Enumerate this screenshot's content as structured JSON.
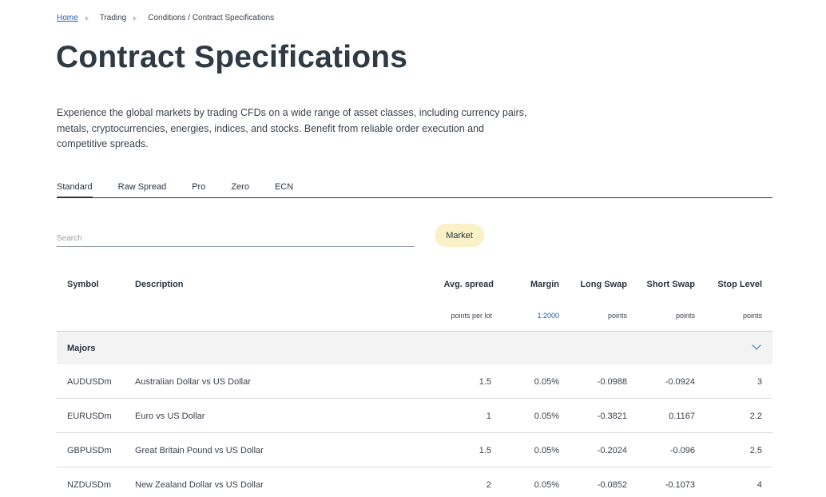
{
  "breadcrumb": {
    "home": "Home",
    "trading": "Trading",
    "current": "Conditions / Contract Specifications"
  },
  "page": {
    "title": "Contract Specifications",
    "intro": "Experience the global markets by trading CFDs on a wide range of asset classes, including currency pairs, metals, cryptocurrencies, energies, indices, and stocks. Benefit from reliable order execution and competitive spreads."
  },
  "tabs": [
    {
      "label": "Standard",
      "active": true
    },
    {
      "label": "Raw Spread"
    },
    {
      "label": "Pro"
    },
    {
      "label": "Zero"
    },
    {
      "label": "ECN"
    }
  ],
  "search": {
    "placeholder": "Search",
    "value": ""
  },
  "filter": {
    "market_label": "Market"
  },
  "table": {
    "headers": {
      "symbol": "Symbol",
      "description": "Description",
      "avg_spread": "Avg. spread",
      "margin": "Margin",
      "long_swap": "Long Swap",
      "short_swap": "Short Swap",
      "stop_level": "Stop Level"
    },
    "subheaders": {
      "avg_spread": "points per lot",
      "margin": "1:2000",
      "long_swap": "points",
      "short_swap": "points",
      "stop_level": "points"
    },
    "group": "Majors",
    "rows": [
      {
        "symbol": "AUDUSDm",
        "description": "Australian Dollar vs US Dollar",
        "avg_spread": "1.5",
        "margin": "0.05%",
        "long_swap": "-0.0988",
        "short_swap": "-0.0924",
        "stop_level": "3"
      },
      {
        "symbol": "EURUSDm",
        "description": "Euro vs US Dollar",
        "avg_spread": "1",
        "margin": "0.05%",
        "long_swap": "-0.3821",
        "short_swap": "0.1167",
        "stop_level": "2.2"
      },
      {
        "symbol": "GBPUSDm",
        "description": "Great Britain Pound vs US Dollar",
        "avg_spread": "1.5",
        "margin": "0.05%",
        "long_swap": "-0.2024",
        "short_swap": "-0.096",
        "stop_level": "2.5"
      },
      {
        "symbol": "NZDUSDm",
        "description": "New Zealand Dollar vs US Dollar",
        "avg_spread": "2",
        "margin": "0.05%",
        "long_swap": "-0.0852",
        "short_swap": "-0.1073",
        "stop_level": "4"
      }
    ]
  },
  "colors": {
    "accent": "#1f5fa8",
    "market_button": "#fbf1c6",
    "group_bg": "#f3f3f4",
    "text": "#2b3440"
  },
  "icons": {
    "breadcrumb_separator": "caret-right-icon",
    "group_toggle": "chevron-down-icon"
  }
}
